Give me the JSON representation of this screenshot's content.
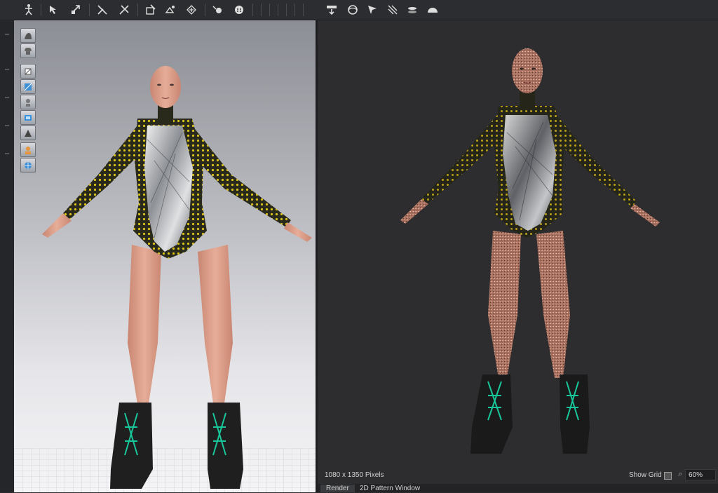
{
  "toolbar": {
    "icons": [
      "avatar-pose-icon",
      "select-move-icon",
      "transform-pattern-icon",
      "edit-pattern-icon",
      "sewing-icon",
      "segment-sewing-icon",
      "fold-icon",
      "tack-icon",
      "pin-icon",
      "button-icon",
      "buttonhole-icon",
      "render-icon",
      "ipr-render-icon",
      "light-icon",
      "camera-icon",
      "environment-icon",
      "dome-light-icon"
    ]
  },
  "viewport_tools": [
    "avatar-display-icon",
    "garment-display-icon",
    "fabric-display-icon",
    "texture-display-icon",
    "avatar-skin-icon",
    "show-pattern-icon",
    "mesh-display-icon",
    "show-avatar-icon",
    "environment-sphere-icon"
  ],
  "render_panel": {
    "image_size": "1080 x 1350 Pixels",
    "show_grid_label": "Show Grid",
    "zoom_value": "60%"
  },
  "tabs": [
    {
      "label": "Render",
      "active": true
    },
    {
      "label": "2D Pattern Window",
      "active": false
    }
  ],
  "colors": {
    "skin": "#e1a893",
    "suit_dark": "#2a2a1c",
    "suit_dots": "#d8c11c",
    "metal": "#c7c9cc",
    "boot": "#1f1f1f",
    "lace": "#18c79a"
  }
}
